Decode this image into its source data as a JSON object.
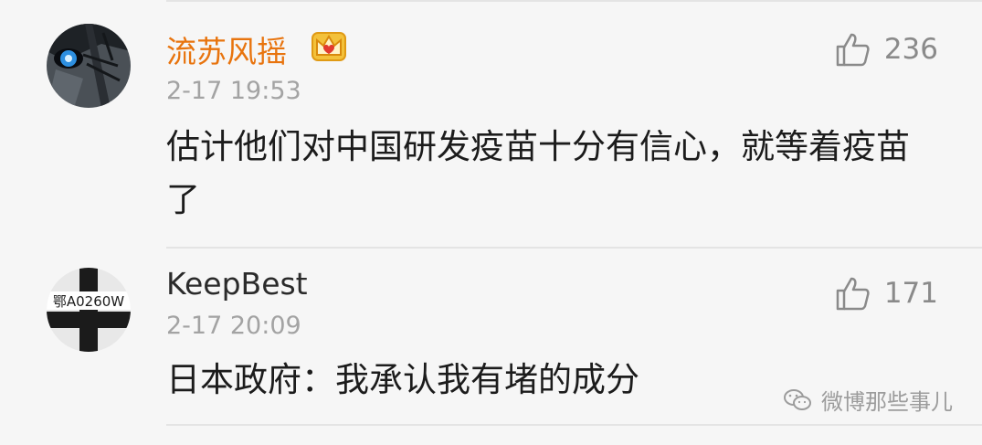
{
  "comments": [
    {
      "username": "流苏风摇",
      "badge_icon": "crown-icon",
      "time": "2-17 19:53",
      "text": "估计他们对中国研发疫苗十分有信心，就等着疫苗了",
      "likes": "236",
      "name_color": "#e8740e"
    },
    {
      "username": "KeepBest",
      "avatar_text": "鄂A0260W",
      "time": "2-17 20:09",
      "text": "日本政府：我承认我有堵的成分",
      "likes": "171"
    }
  ],
  "watermark": {
    "icon": "wechat-icon",
    "text": "微博那些事儿"
  }
}
